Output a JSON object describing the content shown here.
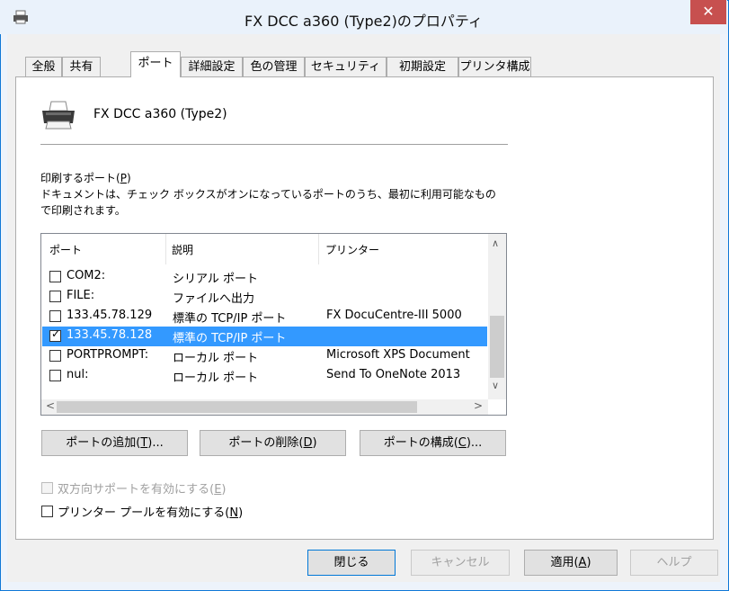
{
  "window": {
    "title": "FX DCC a360 (Type2)のプロパティ",
    "close_glyph": "✕"
  },
  "tabs": [
    "全般",
    "共有",
    "ポート",
    "詳細設定",
    "色の管理",
    "セキュリティ",
    "初期設定",
    "プリンタ構成"
  ],
  "active_tab": "ポート",
  "printer_name": "FX DCC a360 (Type2)",
  "ports_label": "印刷するポート(P)",
  "ports_desc_line1": "ドキュメントは、チェック ボックスがオンになっているポートのうち、最初に利用可能なもの",
  "ports_desc_line2": "で印刷されます。",
  "list": {
    "headers": [
      "ポート",
      "説明",
      "プリンター"
    ],
    "rows": [
      {
        "port": "COM2:",
        "desc": "シリアル ポート",
        "printer": "",
        "checked": false,
        "selected": false
      },
      {
        "port": "FILE:",
        "desc": "ファイルへ出力",
        "printer": "",
        "checked": false,
        "selected": false
      },
      {
        "port": "133.45.78.129",
        "desc": "標準の TCP/IP ポート",
        "printer": "FX DocuCentre-III 5000",
        "checked": false,
        "selected": false
      },
      {
        "port": "133.45.78.128",
        "desc": "標準の TCP/IP ポート",
        "printer": "",
        "checked": true,
        "selected": true
      },
      {
        "port": "PORTPROMPT:",
        "desc": "ローカル ポート",
        "printer": "Microsoft XPS Document",
        "checked": false,
        "selected": false
      },
      {
        "port": "nul:",
        "desc": "ローカル ポート",
        "printer": "Send To OneNote 2013",
        "checked": false,
        "selected": false
      }
    ]
  },
  "buttons": {
    "add_port": "ポートの追加(T)...",
    "delete_port": "ポートの削除(D)",
    "configure_port": "ポートの構成(C)..."
  },
  "checkboxes": {
    "bidirectional": {
      "label": "双方向サポートを有効にする(E)",
      "checked": false,
      "enabled": false
    },
    "pooling": {
      "label": "プリンター プールを有効にする(N)",
      "checked": false,
      "enabled": true
    }
  },
  "footer": {
    "close": "閉じる",
    "cancel": "キャンセル",
    "apply": "適用(A)",
    "help": "ヘルプ"
  },
  "colors": {
    "accent": "#0078d7",
    "selection": "#3399ff",
    "close_button": "#c7504f"
  }
}
